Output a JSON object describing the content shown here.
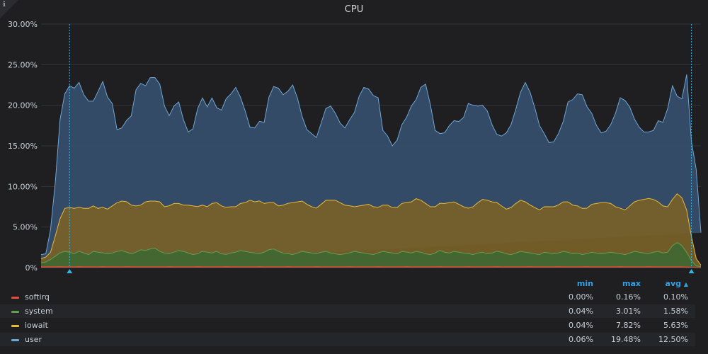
{
  "panel": {
    "title": "CPU",
    "info_icon": "info-icon"
  },
  "chart_data": {
    "type": "area",
    "stacked": true,
    "title": "CPU",
    "ylim": [
      0,
      30
    ],
    "yticks": [
      "0%",
      "5.00%",
      "10.00%",
      "15.00%",
      "20.00%",
      "25.00%",
      "30.00%"
    ],
    "ytick_values": [
      0,
      5,
      10,
      15,
      20,
      25,
      30
    ],
    "grid": true,
    "legend_placement": "bottom",
    "n_points": 140,
    "series": [
      {
        "name": "softirq",
        "color": "#e24d42",
        "fill": "#e24d42",
        "values": [
          0.1,
          0.1,
          0.1,
          0.1,
          0.12,
          0.1,
          0.1,
          0.1,
          0.12,
          0.1,
          0.1,
          0.1,
          0.1,
          0.12,
          0.1,
          0.1,
          0.1,
          0.1,
          0.12,
          0.1,
          0.1,
          0.1,
          0.1,
          0.1,
          0.1,
          0.1,
          0.1,
          0.12,
          0.1,
          0.1,
          0.1,
          0.1,
          0.1,
          0.12,
          0.1,
          0.1,
          0.1,
          0.1,
          0.1,
          0.12,
          0.1,
          0.1,
          0.1,
          0.1,
          0.1,
          0.1,
          0.12,
          0.1,
          0.1,
          0.1,
          0.1,
          0.1,
          0.12,
          0.1,
          0.1,
          0.1,
          0.1,
          0.1,
          0.12,
          0.1,
          0.1,
          0.1,
          0.1,
          0.1,
          0.1,
          0.12,
          0.1,
          0.1,
          0.1,
          0.1,
          0.1,
          0.12,
          0.1,
          0.1,
          0.1,
          0.1,
          0.1,
          0.12,
          0.1,
          0.1,
          0.1,
          0.1,
          0.1,
          0.1,
          0.12,
          0.1,
          0.1,
          0.1,
          0.1,
          0.1,
          0.12,
          0.1,
          0.1,
          0.1,
          0.1,
          0.1,
          0.12,
          0.1,
          0.1,
          0.1,
          0.1,
          0.1,
          0.1,
          0.12,
          0.1,
          0.1,
          0.1,
          0.1,
          0.1,
          0.12,
          0.1,
          0.1,
          0.1,
          0.1,
          0.1,
          0.12,
          0.1,
          0.1,
          0.1,
          0.1,
          0.1,
          0.1,
          0.12,
          0.1,
          0.1,
          0.1,
          0.1,
          0.1,
          0.12,
          0.1,
          0.1,
          0.1,
          0.1,
          0.1,
          0.1,
          0.1,
          0.08,
          0.05,
          0.02,
          0.0
        ]
      },
      {
        "name": "system",
        "color": "#629e51",
        "fill": "#3f6833",
        "values": [
          0.5,
          0.6,
          0.9,
          1.3,
          1.7,
          1.9,
          1.8,
          1.6,
          1.9,
          1.7,
          1.5,
          1.9,
          1.8,
          1.7,
          1.6,
          1.7,
          1.9,
          2.0,
          1.8,
          1.6,
          1.8,
          2.1,
          2.0,
          2.2,
          2.3,
          1.9,
          1.7,
          1.6,
          1.8,
          2.0,
          1.9,
          1.7,
          1.5,
          1.6,
          1.9,
          1.8,
          1.7,
          1.9,
          1.6,
          1.5,
          1.7,
          1.8,
          2.0,
          1.9,
          1.8,
          1.7,
          1.6,
          1.8,
          2.1,
          2.2,
          1.9,
          1.7,
          1.6,
          1.5,
          1.7,
          1.9,
          1.8,
          1.7,
          1.6,
          1.8,
          1.9,
          1.7,
          1.6,
          1.5,
          1.6,
          1.7,
          1.9,
          1.8,
          1.7,
          1.6,
          1.5,
          1.7,
          1.9,
          1.8,
          1.7,
          1.6,
          1.9,
          1.8,
          1.7,
          1.9,
          1.8,
          1.6,
          1.5,
          1.7,
          2.0,
          1.8,
          1.7,
          1.9,
          1.8,
          1.7,
          1.6,
          1.5,
          1.7,
          1.8,
          1.6,
          1.7,
          1.9,
          1.8,
          1.6,
          1.5,
          1.7,
          1.9,
          1.8,
          1.7,
          1.6,
          1.5,
          1.8,
          1.7,
          1.6,
          1.7,
          1.9,
          1.8,
          1.6,
          1.7,
          1.5,
          1.6,
          1.8,
          1.7,
          1.6,
          1.7,
          1.8,
          1.7,
          1.6,
          1.5,
          1.7,
          1.9,
          1.8,
          1.7,
          1.6,
          1.8,
          1.9,
          1.7,
          1.8,
          2.6,
          3.0,
          2.6,
          1.8,
          0.8,
          0.2,
          0.1
        ]
      },
      {
        "name": "iowait",
        "color": "#eab839",
        "fill": "#7a6227",
        "values": [
          0.5,
          0.6,
          0.9,
          2.5,
          4.2,
          5.3,
          5.5,
          5.6,
          5.4,
          5.5,
          5.7,
          5.6,
          5.4,
          5.6,
          5.5,
          5.8,
          6.0,
          6.1,
          6.2,
          6.0,
          5.7,
          5.5,
          6.0,
          5.9,
          5.8,
          6.1,
          5.7,
          5.9,
          6.0,
          5.8,
          5.7,
          5.9,
          6.0,
          5.8,
          5.7,
          5.6,
          6.1,
          6.0,
          5.9,
          5.8,
          5.7,
          5.6,
          5.8,
          6.0,
          6.4,
          6.3,
          6.5,
          6.0,
          5.8,
          5.7,
          5.6,
          5.9,
          6.2,
          6.4,
          6.3,
          6.2,
          5.9,
          5.7,
          5.6,
          5.9,
          6.3,
          6.5,
          6.6,
          6.4,
          6.0,
          5.8,
          5.5,
          5.7,
          5.9,
          6.1,
          5.9,
          5.6,
          5.7,
          5.8,
          5.6,
          5.7,
          5.9,
          6.1,
          6.3,
          6.5,
          6.4,
          6.2,
          5.9,
          5.7,
          5.8,
          6.0,
          6.2,
          6.1,
          5.9,
          5.7,
          5.6,
          5.9,
          6.2,
          6.5,
          6.6,
          6.3,
          6.0,
          5.7,
          5.5,
          5.8,
          6.1,
          6.3,
          6.2,
          5.9,
          5.7,
          5.5,
          5.6,
          5.7,
          5.8,
          5.9,
          6.1,
          6.2,
          6.0,
          5.8,
          5.7,
          5.6,
          5.9,
          6.1,
          6.3,
          6.2,
          6.0,
          5.7,
          5.6,
          5.5,
          5.8,
          6.1,
          6.4,
          6.6,
          6.8,
          6.5,
          6.1,
          5.8,
          5.6,
          5.7,
          6.0,
          5.9,
          5.2,
          3.0,
          0.9,
          0.2
        ]
      },
      {
        "name": "user",
        "color": "#6ea6d6",
        "fill": "#35506e",
        "values": [
          0.5,
          0.4,
          2.8,
          6.6,
          12.2,
          14.1,
          15.0,
          14.8,
          15.4,
          14.0,
          13.2,
          12.9,
          14.4,
          15.5,
          13.8,
          12.6,
          9.0,
          9.0,
          10.0,
          11.0,
          14.3,
          15.0,
          14.3,
          15.2,
          15.2,
          14.5,
          12.4,
          11.1,
          12.0,
          12.5,
          10.5,
          9.0,
          9.5,
          12.1,
          13.2,
          12.3,
          13.0,
          11.7,
          11.8,
          13.4,
          13.9,
          14.7,
          13.1,
          11.3,
          9.0,
          9.1,
          9.8,
          10.0,
          13.0,
          14.3,
          14.5,
          13.6,
          13.8,
          14.5,
          12.8,
          10.4,
          9.2,
          9.0,
          8.7,
          10.0,
          11.3,
          11.6,
          10.7,
          9.8,
          9.5,
          10.6,
          11.6,
          13.5,
          14.5,
          14.2,
          13.7,
          13.5,
          9.2,
          8.5,
          7.6,
          8.3,
          9.7,
          10.5,
          11.8,
          12.2,
          13.9,
          14.7,
          12.6,
          9.4,
          8.6,
          8.7,
          9.5,
          10.0,
          10.2,
          11.0,
          12.9,
          12.5,
          11.9,
          11.6,
          11.0,
          9.5,
          8.4,
          8.6,
          9.4,
          10.2,
          11.6,
          13.3,
          14.7,
          13.9,
          12.3,
          10.4,
          9.0,
          7.9,
          8.0,
          8.8,
          9.9,
          12.3,
          13.0,
          13.8,
          14.0,
          12.5,
          11.2,
          9.6,
          8.6,
          8.8,
          9.7,
          11.5,
          13.6,
          13.5,
          12.2,
          10.2,
          9.0,
          8.3,
          8.2,
          8.5,
          10.0,
          10.3,
          12.1,
          14.0,
          12.0,
          12.2,
          16.7,
          11.7,
          11.0,
          4.0,
          0.1,
          0.0
        ]
      }
    ],
    "legend": {
      "columns": [
        "min",
        "max",
        "avg"
      ],
      "sort_indicator": "▲",
      "rows": [
        {
          "name": "softirq",
          "min": "0.00%",
          "max": "0.16%",
          "avg": "0.10%"
        },
        {
          "name": "system",
          "min": "0.04%",
          "max": "3.01%",
          "avg": "1.58%"
        },
        {
          "name": "iowait",
          "min": "0.04%",
          "max": "7.82%",
          "avg": "5.63%"
        },
        {
          "name": "user",
          "min": "0.06%",
          "max": "19.48%",
          "avg": "12.50%"
        }
      ]
    },
    "markers": {
      "color": "#33b5e5",
      "positions": [
        6,
        137
      ]
    }
  }
}
